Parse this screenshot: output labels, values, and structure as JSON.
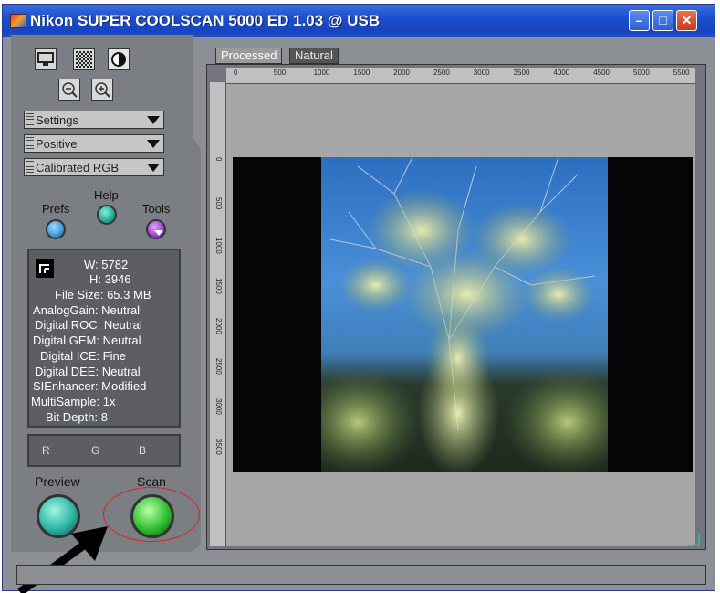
{
  "window": {
    "title": "Nikon SUPER COOLSCAN 5000 ED 1.03 @ USB",
    "minimize_glyph": "–",
    "maximize_glyph": "□",
    "close_glyph": "✕"
  },
  "tools": {
    "icons": [
      "monitor-icon",
      "checkerboard-icon",
      "contrast-icon",
      "zoom-out-icon",
      "zoom-in-icon"
    ]
  },
  "dropdowns": {
    "settings": "Settings",
    "film_type": "Positive",
    "color_space": "Calibrated RGB"
  },
  "buttons": {
    "prefs": "Prefs",
    "help": "Help",
    "tools": "Tools",
    "preview": "Preview",
    "scan": "Scan"
  },
  "info": {
    "width": "W: 5782",
    "height": "H: 3946",
    "file_size": "File Size: 65.3 MB",
    "analog_gain": "AnalogGain: Neutral",
    "digital_roc": "Digital ROC: Neutral",
    "digital_gem": "Digital GEM: Neutral",
    "digital_ice": "Digital ICE: Fine",
    "digital_dee": "Digital DEE: Neutral",
    "si_enhancer": "SIEnhancer: Modified",
    "multisample": "MultiSample: 1x",
    "bit_depth": "Bit Depth: 8"
  },
  "rgb": {
    "r": "R",
    "g": "G",
    "b": "B"
  },
  "tabs": [
    "Processed",
    "Natural"
  ],
  "ruler": {
    "top": [
      "0",
      "500",
      "1000",
      "1500",
      "2000",
      "2500",
      "3000",
      "3500",
      "4000",
      "4500",
      "5000",
      "5500"
    ],
    "left": [
      "0",
      "500",
      "1000",
      "1500",
      "2000",
      "2500",
      "3000",
      "3500"
    ]
  },
  "colors": {
    "title_blue": "#1b4fd0",
    "panel_gray": "#7b7e82",
    "preview_button": "#2fb5a3",
    "scan_button": "#30c030",
    "help_button": "#25a892",
    "prefs_button": "#3a9bd8",
    "tools_button": "#9b3fd0",
    "highlight": "#e02020"
  }
}
